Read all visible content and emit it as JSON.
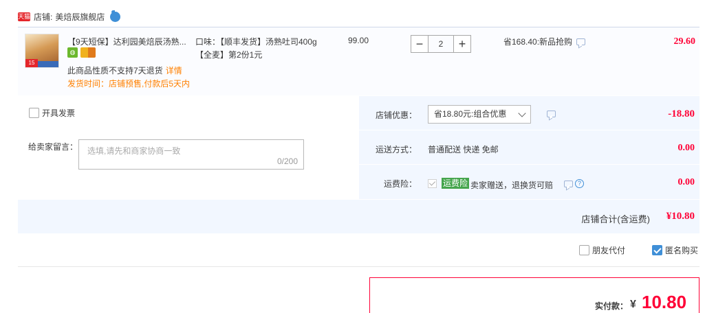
{
  "shop": {
    "badge": "天猫",
    "label": "店铺:",
    "name": "美焙辰旗舰店"
  },
  "item": {
    "thumb_tag": "15",
    "title": "【9天短保】达利园美焙辰汤熟...",
    "no_return": "此商品性质不支持7天退货",
    "detail_link": "详情",
    "ship_time": "发货时间：店铺预售,付款后5天内",
    "sku": "口味：【顺丰发货】汤熟吐司400g【全麦】第2份1元",
    "unit_price": "99.00",
    "qty_minus": "−",
    "quantity": "2",
    "qty_plus": "+",
    "promo": "省168.40:新品抢购",
    "total": "29.60"
  },
  "options": {
    "invoice_label": "开具发票",
    "message_label": "给卖家留言：",
    "message_placeholder": "选填,请先和商家协商一致",
    "message_count": "0/200"
  },
  "discount": {
    "label": "店铺优惠：",
    "selected": "省18.80元:组合优惠",
    "amount": "-18.80"
  },
  "shipping": {
    "label": "运送方式：",
    "text": "普通配送 快递 免邮",
    "amount": "0.00"
  },
  "insurance": {
    "label": "运费险：",
    "tag": "运费险",
    "text": "卖家赠送，退换货可赔",
    "help": "?",
    "amount": "0.00"
  },
  "shop_total": {
    "label": "店铺合计(含运费)",
    "value": "¥10.80"
  },
  "extras": {
    "friend_pay": "朋友代付",
    "anonymous": "匿名购买"
  },
  "payment": {
    "label": "实付款：",
    "currency": "¥",
    "value": "10.80"
  },
  "colors": {
    "accent_red": "#ff0036",
    "orange": "#ff8000",
    "panel_blue": "#f2f7ff",
    "check_blue": "#3f8fd7",
    "insurance_green": "#45a54c"
  },
  "icons": {
    "shop_chat": "chat-bubble-icon",
    "message": "message-icon",
    "help": "help-circle-icon",
    "chevron": "chevron-down-icon"
  }
}
